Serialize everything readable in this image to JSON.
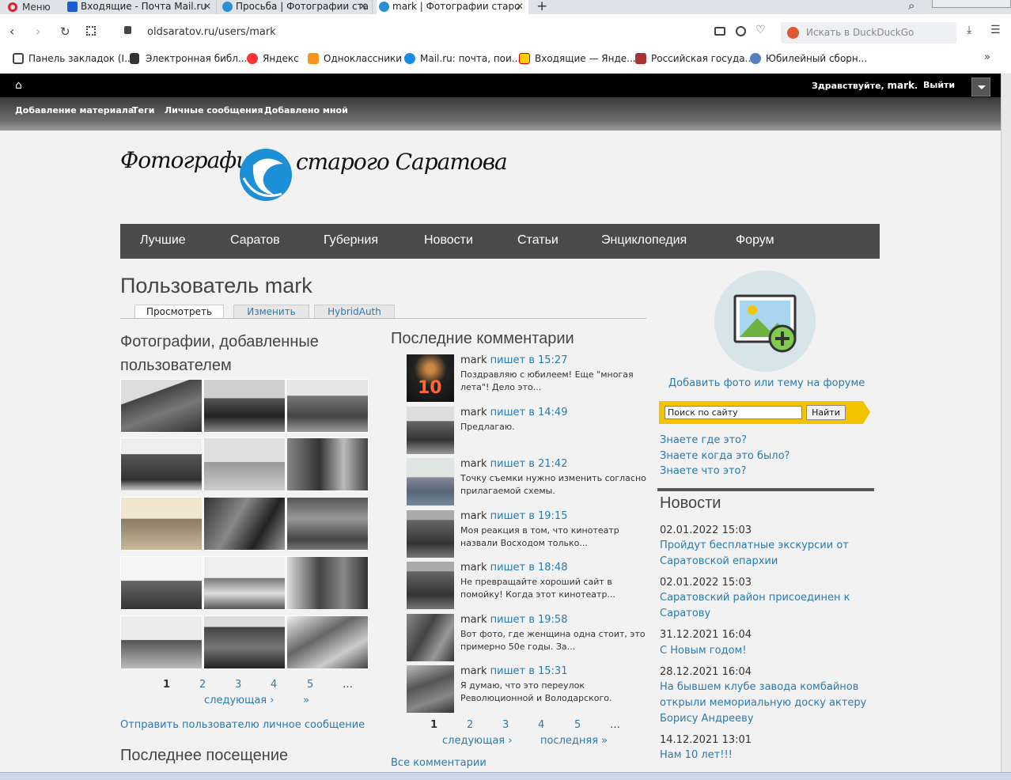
{
  "browser": {
    "menu_label": "Меню",
    "tabs": [
      {
        "label": "Входящие - Почта Mail.ru",
        "icon": "mail-icon"
      },
      {
        "label": "Просьба | Фотографии ста",
        "icon": "site-icon"
      },
      {
        "label": "mark | Фотографии старо",
        "icon": "site-icon"
      }
    ],
    "url": "oldsaratov.ru/users/mark",
    "search_placeholder": "Искать в DuckDuckGo",
    "bookmarks": [
      "Панель закладок (I...",
      "Электронная библ...",
      "Яндекс",
      "Одноклассники",
      "Mail.ru: почта, пои...",
      "Входящие — Янде...",
      "Российская госуда...",
      "Юбилейный сборн..."
    ]
  },
  "site": {
    "greeting": "Здравствуйте, ",
    "username": "mark",
    "greeting_end": ".",
    "logout": "Выйти",
    "subnav": [
      "Добавление материала",
      "Теги",
      "Личные сообщения",
      "Добавлено мной"
    ],
    "logo_left": "Фотографии",
    "logo_right": "старого Саратова",
    "mainnav": [
      "Лучшие",
      "Саратов",
      "Губерния",
      "Новости",
      "Статьи",
      "Энциклопедия",
      "Форум"
    ]
  },
  "profile": {
    "title": "Пользователь mark",
    "tabs": [
      "Просмотреть",
      "Изменить",
      "HybridAuth"
    ],
    "photos_heading_1": "Фотографии, добавленные",
    "photos_heading_2": "пользователем",
    "photo_pager": {
      "current": "1",
      "pages": [
        "2",
        "3",
        "4",
        "5"
      ],
      "ellipsis": "…",
      "next": "следующая ›",
      "last": "»"
    },
    "send_message": "Отправить пользователю личное сообщение",
    "last_visit": "Последнее посещение"
  },
  "comments": {
    "heading": "Последние комментарии",
    "author": "mark",
    "verb": "пишет",
    "items": [
      {
        "time": "в 15:27",
        "text": "Поздравляю с юбилеем! Еще \"многая лета\"! Дело это..."
      },
      {
        "time": "в 14:49",
        "text": "Предлагаю."
      },
      {
        "time": "в 21:42",
        "text": "Точку съемки нужно изменить согласно прилагаемой схемы."
      },
      {
        "time": "в 19:15",
        "text": "Моя реакция в том, что кинотеатр назвали Восходом только..."
      },
      {
        "time": "в 18:48",
        "text": "Не превращайте хороший сайт в помойку! Когда этот кинотеатр..."
      },
      {
        "time": "в 19:58",
        "text": "Вот фото, где женщина одна стоит, это примерно 50е годы. За..."
      },
      {
        "time": "в 15:31",
        "text": "Я думаю, что это переулок Революционной и Володарского."
      }
    ],
    "pager": {
      "current": "1",
      "pages": [
        "2",
        "3",
        "4",
        "5"
      ],
      "ellipsis": "…",
      "next": "следующая ›",
      "last": "последняя »"
    },
    "all": "Все комментарии"
  },
  "sidebar": {
    "add_photo": "Добавить фото или тему на форуме",
    "search_placeholder": "Поиск по сайту",
    "search_button": "Найти",
    "quiz": [
      "Знаете где это?",
      "Знаете когда это было?",
      "Знаете что это?"
    ],
    "news_heading": "Новости",
    "news": [
      {
        "date": "02.01.2022 15:03",
        "title": "Пройдут бесплатные экскурсии от Саратовской епархии"
      },
      {
        "date": "02.01.2022 15:03",
        "title": "Саратовский район присоединен к Саратову"
      },
      {
        "date": "31.12.2021 16:04",
        "title": "С Новым годом!"
      },
      {
        "date": "28.12.2021 16:04",
        "title": "На бывшем клубе завода комбайнов открыли мемориальную доску актеру Борису Андрееву"
      },
      {
        "date": "14.12.2021 13:01",
        "title": "Нам 10 лет!!!"
      }
    ]
  },
  "colors": {
    "link": "#2a7ab0",
    "nav_bg": "#4a4a4a",
    "search_bar": "#f3c300",
    "logo_blue": "#1c8fd6"
  }
}
